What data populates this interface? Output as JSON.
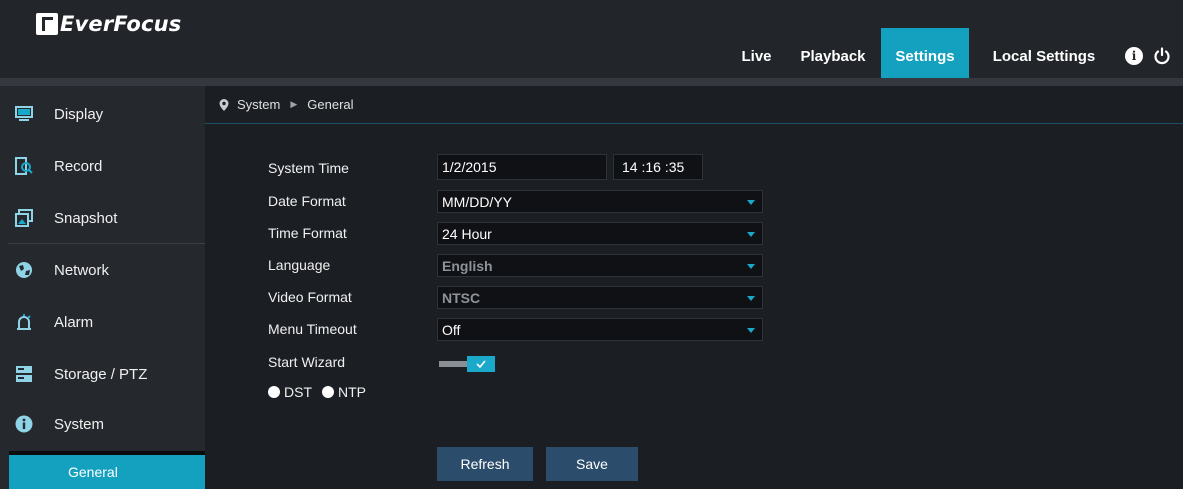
{
  "brand": {
    "name": "EverFocus"
  },
  "nav": {
    "live": "Live",
    "playback": "Playback",
    "settings": "Settings",
    "local_settings": "Local Settings",
    "active": "Settings"
  },
  "sidebar": {
    "items": [
      {
        "label": "Display",
        "icon": "monitor-icon"
      },
      {
        "label": "Record",
        "icon": "record-search-icon"
      },
      {
        "label": "Snapshot",
        "icon": "snapshot-icon"
      },
      {
        "label": "Network",
        "icon": "globe-icon"
      },
      {
        "label": "Alarm",
        "icon": "alarm-icon"
      },
      {
        "label": "Storage / PTZ",
        "icon": "storage-icon"
      },
      {
        "label": "System",
        "icon": "info-circle-icon"
      }
    ],
    "subitem": {
      "label": "General",
      "selected": true
    }
  },
  "breadcrumb": {
    "root": "System",
    "current": "General"
  },
  "form": {
    "system_time": {
      "label": "System Time",
      "date": "1/2/2015",
      "time": "14 :16 :35"
    },
    "date_format": {
      "label": "Date Format",
      "value": "MM/DD/YY"
    },
    "time_format": {
      "label": "Time Format",
      "value": "24 Hour"
    },
    "language": {
      "label": "Language",
      "value": "English",
      "disabled": true
    },
    "video_format": {
      "label": "Video Format",
      "value": "NTSC",
      "disabled": true
    },
    "menu_timeout": {
      "label": "Menu Timeout",
      "value": "Off"
    },
    "start_wizard": {
      "label": "Start Wizard",
      "enabled": true
    },
    "dst": {
      "label": "DST"
    },
    "ntp": {
      "label": "NTP"
    }
  },
  "buttons": {
    "refresh": "Refresh",
    "save": "Save"
  },
  "colors": {
    "accent": "#14a0bf",
    "button": "#2c4c6b",
    "background": "#1b1e23",
    "sidebar": "#25282d"
  }
}
